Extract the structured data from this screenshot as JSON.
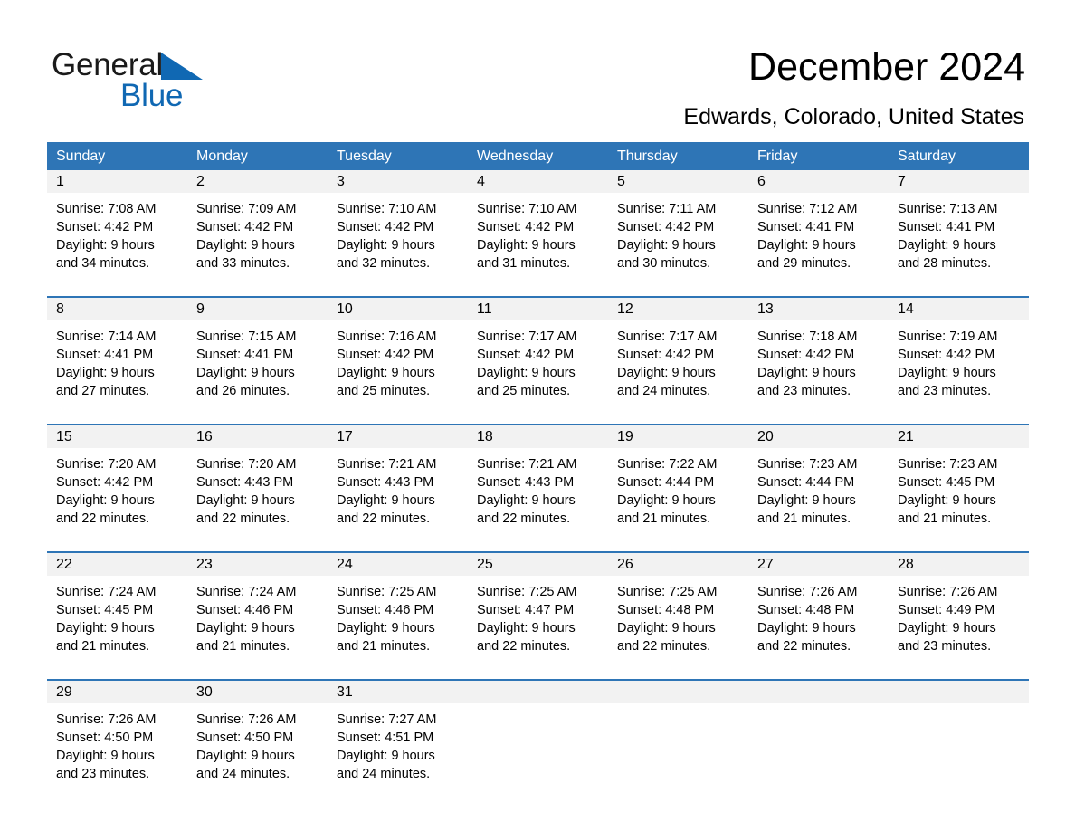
{
  "brand": {
    "name_part1": "General",
    "name_part2": "Blue",
    "triangle_color": "#1068b3"
  },
  "header": {
    "title": "December 2024",
    "location": "Edwards, Colorado, United States",
    "header_bg_color": "#2e75b6",
    "row_band_color": "#f2f2f2"
  },
  "weekdays": [
    "Sunday",
    "Monday",
    "Tuesday",
    "Wednesday",
    "Thursday",
    "Friday",
    "Saturday"
  ],
  "weeks": [
    {
      "days": [
        {
          "num": "1",
          "sunrise": "Sunrise: 7:08 AM",
          "sunset": "Sunset: 4:42 PM",
          "daylight_line1": "Daylight: 9 hours",
          "daylight_line2": "and 34 minutes."
        },
        {
          "num": "2",
          "sunrise": "Sunrise: 7:09 AM",
          "sunset": "Sunset: 4:42 PM",
          "daylight_line1": "Daylight: 9 hours",
          "daylight_line2": "and 33 minutes."
        },
        {
          "num": "3",
          "sunrise": "Sunrise: 7:10 AM",
          "sunset": "Sunset: 4:42 PM",
          "daylight_line1": "Daylight: 9 hours",
          "daylight_line2": "and 32 minutes."
        },
        {
          "num": "4",
          "sunrise": "Sunrise: 7:10 AM",
          "sunset": "Sunset: 4:42 PM",
          "daylight_line1": "Daylight: 9 hours",
          "daylight_line2": "and 31 minutes."
        },
        {
          "num": "5",
          "sunrise": "Sunrise: 7:11 AM",
          "sunset": "Sunset: 4:42 PM",
          "daylight_line1": "Daylight: 9 hours",
          "daylight_line2": "and 30 minutes."
        },
        {
          "num": "6",
          "sunrise": "Sunrise: 7:12 AM",
          "sunset": "Sunset: 4:41 PM",
          "daylight_line1": "Daylight: 9 hours",
          "daylight_line2": "and 29 minutes."
        },
        {
          "num": "7",
          "sunrise": "Sunrise: 7:13 AM",
          "sunset": "Sunset: 4:41 PM",
          "daylight_line1": "Daylight: 9 hours",
          "daylight_line2": "and 28 minutes."
        }
      ]
    },
    {
      "days": [
        {
          "num": "8",
          "sunrise": "Sunrise: 7:14 AM",
          "sunset": "Sunset: 4:41 PM",
          "daylight_line1": "Daylight: 9 hours",
          "daylight_line2": "and 27 minutes."
        },
        {
          "num": "9",
          "sunrise": "Sunrise: 7:15 AM",
          "sunset": "Sunset: 4:41 PM",
          "daylight_line1": "Daylight: 9 hours",
          "daylight_line2": "and 26 minutes."
        },
        {
          "num": "10",
          "sunrise": "Sunrise: 7:16 AM",
          "sunset": "Sunset: 4:42 PM",
          "daylight_line1": "Daylight: 9 hours",
          "daylight_line2": "and 25 minutes."
        },
        {
          "num": "11",
          "sunrise": "Sunrise: 7:17 AM",
          "sunset": "Sunset: 4:42 PM",
          "daylight_line1": "Daylight: 9 hours",
          "daylight_line2": "and 25 minutes."
        },
        {
          "num": "12",
          "sunrise": "Sunrise: 7:17 AM",
          "sunset": "Sunset: 4:42 PM",
          "daylight_line1": "Daylight: 9 hours",
          "daylight_line2": "and 24 minutes."
        },
        {
          "num": "13",
          "sunrise": "Sunrise: 7:18 AM",
          "sunset": "Sunset: 4:42 PM",
          "daylight_line1": "Daylight: 9 hours",
          "daylight_line2": "and 23 minutes."
        },
        {
          "num": "14",
          "sunrise": "Sunrise: 7:19 AM",
          "sunset": "Sunset: 4:42 PM",
          "daylight_line1": "Daylight: 9 hours",
          "daylight_line2": "and 23 minutes."
        }
      ]
    },
    {
      "days": [
        {
          "num": "15",
          "sunrise": "Sunrise: 7:20 AM",
          "sunset": "Sunset: 4:42 PM",
          "daylight_line1": "Daylight: 9 hours",
          "daylight_line2": "and 22 minutes."
        },
        {
          "num": "16",
          "sunrise": "Sunrise: 7:20 AM",
          "sunset": "Sunset: 4:43 PM",
          "daylight_line1": "Daylight: 9 hours",
          "daylight_line2": "and 22 minutes."
        },
        {
          "num": "17",
          "sunrise": "Sunrise: 7:21 AM",
          "sunset": "Sunset: 4:43 PM",
          "daylight_line1": "Daylight: 9 hours",
          "daylight_line2": "and 22 minutes."
        },
        {
          "num": "18",
          "sunrise": "Sunrise: 7:21 AM",
          "sunset": "Sunset: 4:43 PM",
          "daylight_line1": "Daylight: 9 hours",
          "daylight_line2": "and 22 minutes."
        },
        {
          "num": "19",
          "sunrise": "Sunrise: 7:22 AM",
          "sunset": "Sunset: 4:44 PM",
          "daylight_line1": "Daylight: 9 hours",
          "daylight_line2": "and 21 minutes."
        },
        {
          "num": "20",
          "sunrise": "Sunrise: 7:23 AM",
          "sunset": "Sunset: 4:44 PM",
          "daylight_line1": "Daylight: 9 hours",
          "daylight_line2": "and 21 minutes."
        },
        {
          "num": "21",
          "sunrise": "Sunrise: 7:23 AM",
          "sunset": "Sunset: 4:45 PM",
          "daylight_line1": "Daylight: 9 hours",
          "daylight_line2": "and 21 minutes."
        }
      ]
    },
    {
      "days": [
        {
          "num": "22",
          "sunrise": "Sunrise: 7:24 AM",
          "sunset": "Sunset: 4:45 PM",
          "daylight_line1": "Daylight: 9 hours",
          "daylight_line2": "and 21 minutes."
        },
        {
          "num": "23",
          "sunrise": "Sunrise: 7:24 AM",
          "sunset": "Sunset: 4:46 PM",
          "daylight_line1": "Daylight: 9 hours",
          "daylight_line2": "and 21 minutes."
        },
        {
          "num": "24",
          "sunrise": "Sunrise: 7:25 AM",
          "sunset": "Sunset: 4:46 PM",
          "daylight_line1": "Daylight: 9 hours",
          "daylight_line2": "and 21 minutes."
        },
        {
          "num": "25",
          "sunrise": "Sunrise: 7:25 AM",
          "sunset": "Sunset: 4:47 PM",
          "daylight_line1": "Daylight: 9 hours",
          "daylight_line2": "and 22 minutes."
        },
        {
          "num": "26",
          "sunrise": "Sunrise: 7:25 AM",
          "sunset": "Sunset: 4:48 PM",
          "daylight_line1": "Daylight: 9 hours",
          "daylight_line2": "and 22 minutes."
        },
        {
          "num": "27",
          "sunrise": "Sunrise: 7:26 AM",
          "sunset": "Sunset: 4:48 PM",
          "daylight_line1": "Daylight: 9 hours",
          "daylight_line2": "and 22 minutes."
        },
        {
          "num": "28",
          "sunrise": "Sunrise: 7:26 AM",
          "sunset": "Sunset: 4:49 PM",
          "daylight_line1": "Daylight: 9 hours",
          "daylight_line2": "and 23 minutes."
        }
      ]
    },
    {
      "days": [
        {
          "num": "29",
          "sunrise": "Sunrise: 7:26 AM",
          "sunset": "Sunset: 4:50 PM",
          "daylight_line1": "Daylight: 9 hours",
          "daylight_line2": "and 23 minutes."
        },
        {
          "num": "30",
          "sunrise": "Sunrise: 7:26 AM",
          "sunset": "Sunset: 4:50 PM",
          "daylight_line1": "Daylight: 9 hours",
          "daylight_line2": "and 24 minutes."
        },
        {
          "num": "31",
          "sunrise": "Sunrise: 7:27 AM",
          "sunset": "Sunset: 4:51 PM",
          "daylight_line1": "Daylight: 9 hours",
          "daylight_line2": "and 24 minutes."
        },
        {
          "num": "",
          "sunrise": "",
          "sunset": "",
          "daylight_line1": "",
          "daylight_line2": ""
        },
        {
          "num": "",
          "sunrise": "",
          "sunset": "",
          "daylight_line1": "",
          "daylight_line2": ""
        },
        {
          "num": "",
          "sunrise": "",
          "sunset": "",
          "daylight_line1": "",
          "daylight_line2": ""
        },
        {
          "num": "",
          "sunrise": "",
          "sunset": "",
          "daylight_line1": "",
          "daylight_line2": ""
        }
      ]
    }
  ]
}
